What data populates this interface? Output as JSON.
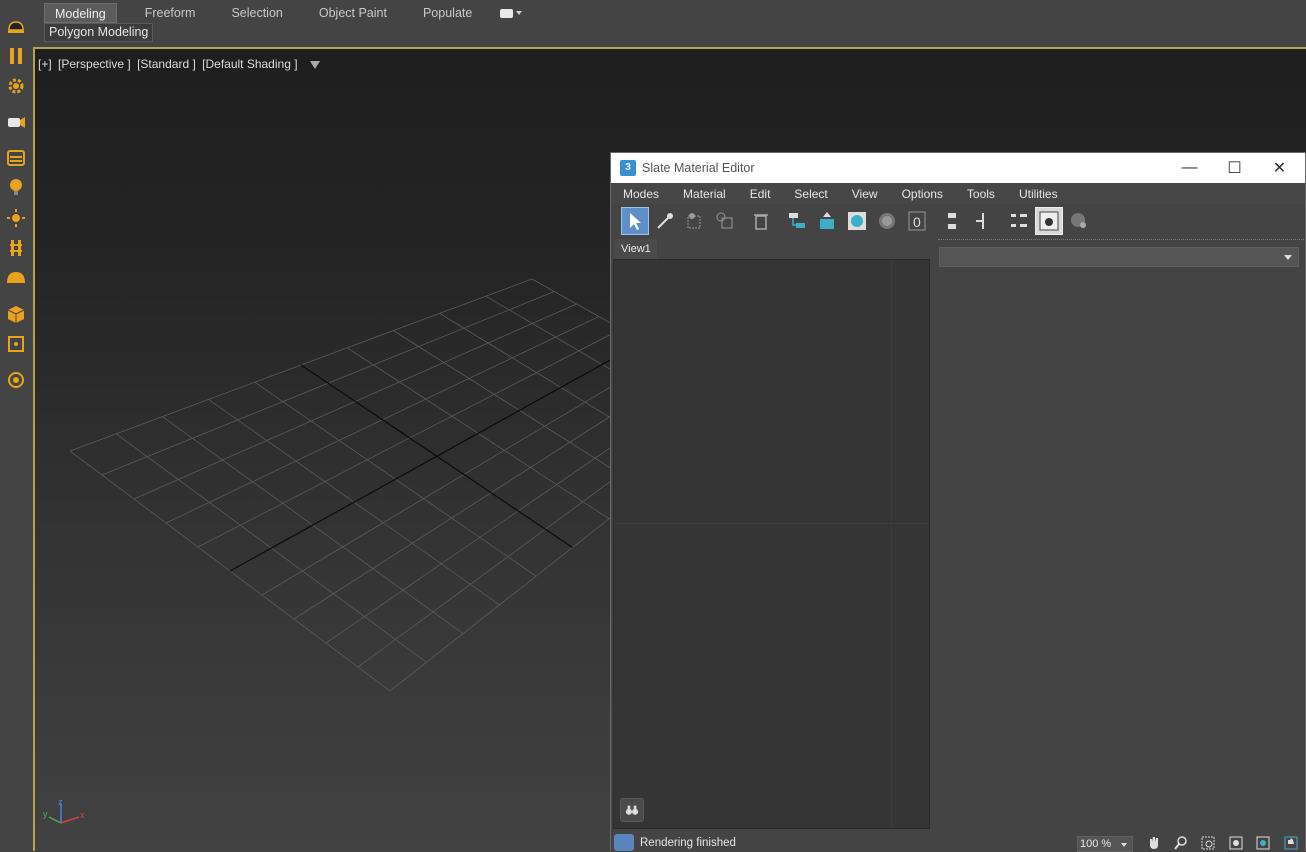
{
  "ribbon": {
    "tabs": [
      "Modeling",
      "Freeform",
      "Selection",
      "Object Paint",
      "Populate"
    ],
    "active_tab": "Modeling",
    "sub_button": "Polygon Modeling"
  },
  "viewport": {
    "labels": [
      "[+]",
      "[Perspective ]",
      "[Standard ]",
      "[Default Shading ]"
    ],
    "axis_labels": {
      "x": "x",
      "y": "y",
      "z": "z"
    }
  },
  "left_toolbar": {
    "icons": [
      "teapot-render-icon",
      "pause-icon",
      "gear-icon",
      "camera-icon",
      "panel-icon",
      "light-bulb-icon",
      "sun-icon",
      "pillar-icon",
      "dome-icon",
      "box-icon",
      "frame-icon",
      "orbit-icon"
    ]
  },
  "material_editor": {
    "title": "Slate Material Editor",
    "menu": [
      "Modes",
      "Material",
      "Edit",
      "Select",
      "View",
      "Options",
      "Tools",
      "Utilities"
    ],
    "tab": "View1",
    "status": "Rendering finished",
    "zoom": "100 %",
    "accent": "#5e8fc8"
  }
}
